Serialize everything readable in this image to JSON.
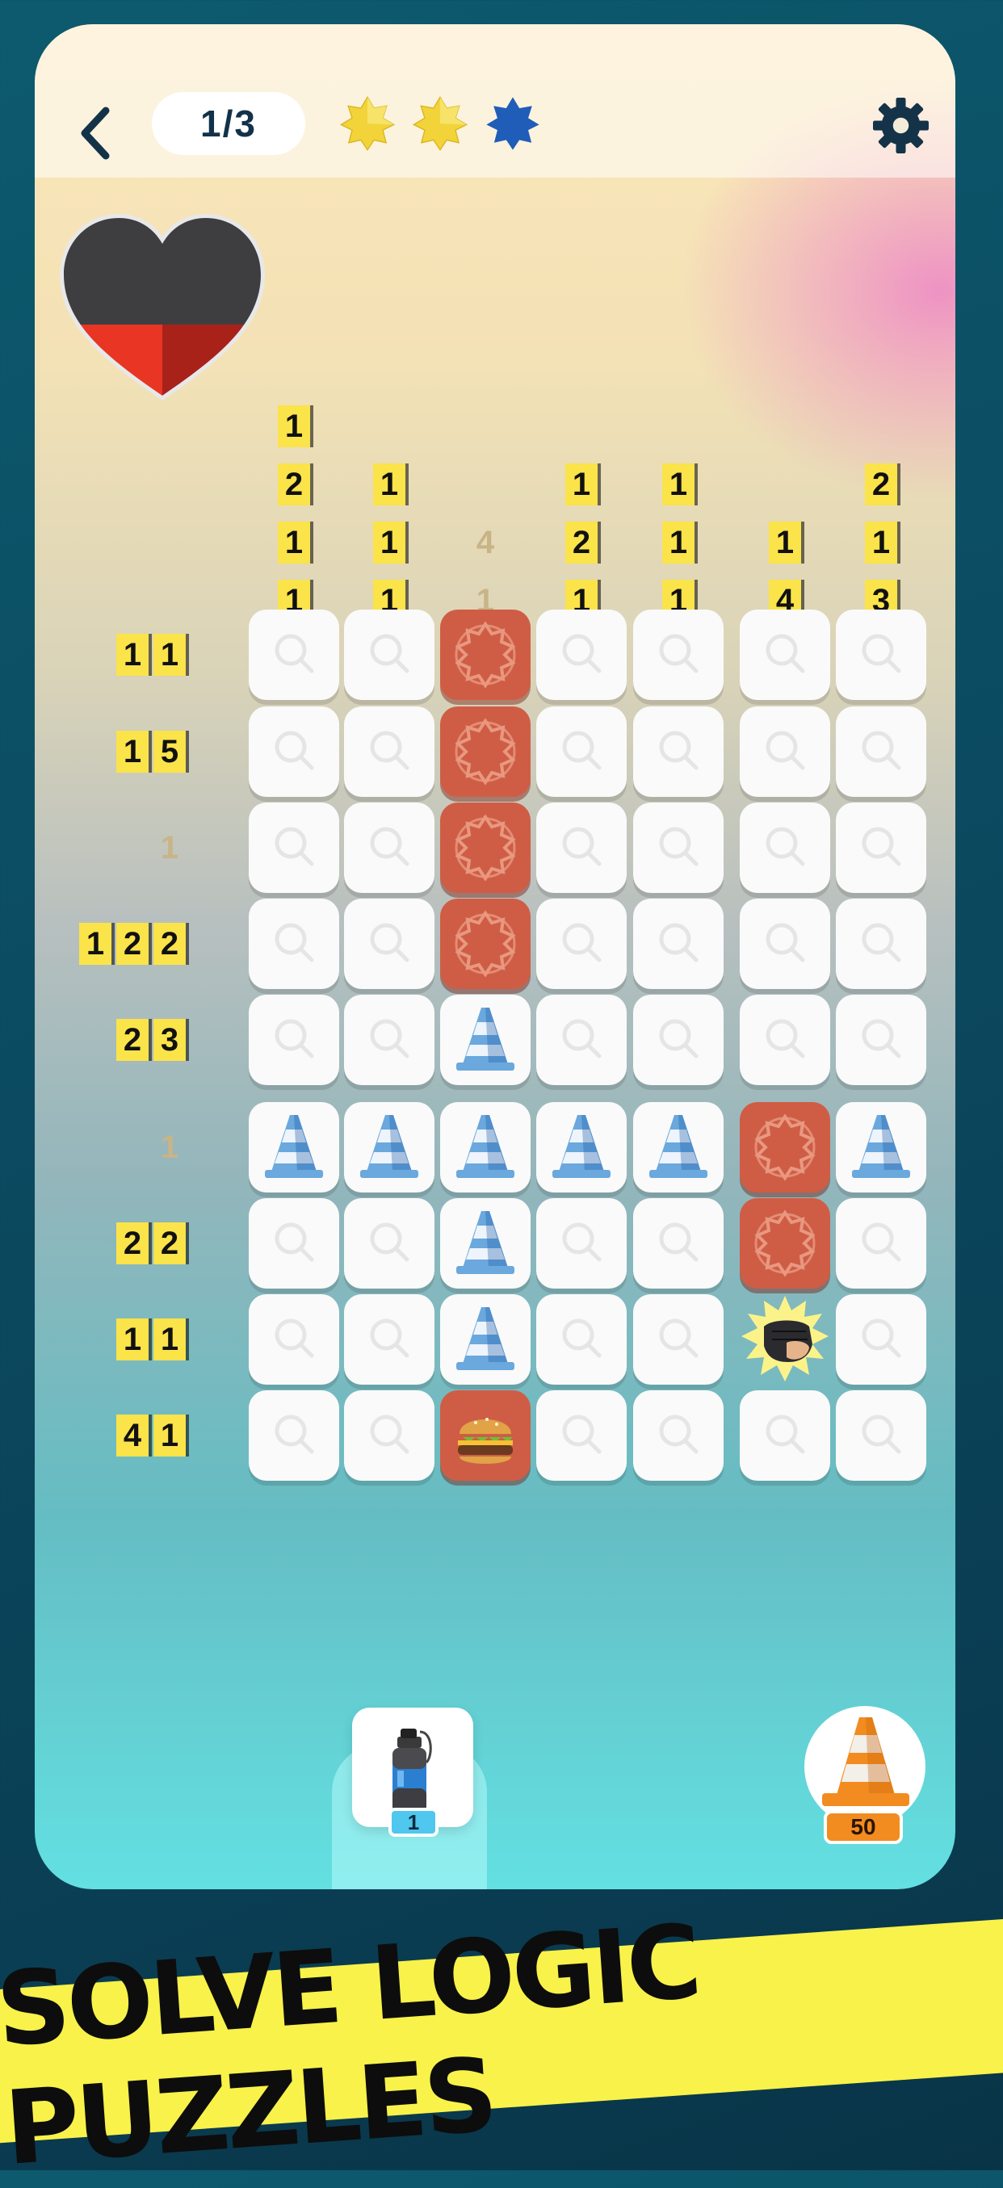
{
  "header": {
    "level_progress": "1/3",
    "stars": [
      {
        "state": "earned",
        "color": "#f2d33a"
      },
      {
        "state": "earned",
        "color": "#f2d33a"
      },
      {
        "state": "current",
        "color": "#1f5db8"
      }
    ],
    "back_icon": "chevron-left-icon",
    "settings_icon": "gear-icon"
  },
  "health": {
    "icon": "heart-icon",
    "fill_fraction": 0.33,
    "fill_color": "#e83524",
    "empty_color": "#3e3e40"
  },
  "column_clues": [
    [
      {
        "v": "1"
      },
      {
        "v": "2"
      },
      {
        "v": "1"
      },
      {
        "v": "1"
      }
    ],
    [
      {
        "v": "1"
      },
      {
        "v": "1"
      },
      {
        "v": "1"
      }
    ],
    [
      {
        "v": "4",
        "done": true
      },
      {
        "v": "1",
        "done": true
      }
    ],
    [
      {
        "v": "1"
      },
      {
        "v": "2"
      },
      {
        "v": "1"
      }
    ],
    [
      {
        "v": "1"
      },
      {
        "v": "1"
      },
      {
        "v": "1"
      }
    ],
    [
      {
        "v": "1"
      },
      {
        "v": "4"
      }
    ],
    [
      {
        "v": "2"
      },
      {
        "v": "1"
      },
      {
        "v": "3"
      }
    ]
  ],
  "row_clues": [
    [
      {
        "v": "1"
      },
      {
        "v": "1"
      }
    ],
    [
      {
        "v": "1"
      },
      {
        "v": "5"
      }
    ],
    [
      {
        "v": "1",
        "done": true
      }
    ],
    [
      {
        "v": "1"
      },
      {
        "v": "2"
      },
      {
        "v": "2"
      }
    ],
    [
      {
        "v": "2"
      },
      {
        "v": "3"
      }
    ],
    [
      {
        "v": "1",
        "done": true
      }
    ],
    [
      {
        "v": "2"
      },
      {
        "v": "2"
      }
    ],
    [
      {
        "v": "1"
      },
      {
        "v": "1"
      }
    ],
    [
      {
        "v": "4"
      },
      {
        "v": "1"
      }
    ]
  ],
  "grid": [
    [
      "unknown",
      "unknown",
      "shield",
      "unknown",
      "unknown",
      "unknown",
      "unknown"
    ],
    [
      "unknown",
      "unknown",
      "shield",
      "unknown",
      "unknown",
      "unknown",
      "unknown"
    ],
    [
      "unknown",
      "unknown",
      "shield",
      "unknown",
      "unknown",
      "unknown",
      "unknown"
    ],
    [
      "unknown",
      "unknown",
      "shield",
      "unknown",
      "unknown",
      "unknown",
      "unknown"
    ],
    [
      "unknown",
      "unknown",
      "cone",
      "unknown",
      "unknown",
      "unknown",
      "unknown"
    ],
    [
      "cone",
      "cone",
      "cone",
      "cone",
      "cone",
      "shield",
      "cone"
    ],
    [
      "unknown",
      "unknown",
      "cone",
      "unknown",
      "unknown",
      "shield",
      "unknown"
    ],
    [
      "unknown",
      "unknown",
      "cone",
      "unknown",
      "unknown",
      "fist",
      "unknown"
    ],
    [
      "unknown",
      "unknown",
      "burger",
      "unknown",
      "unknown",
      "unknown",
      "unknown"
    ]
  ],
  "powerups": {
    "spray": {
      "icon": "spray-can-icon",
      "count": "1"
    },
    "cones": {
      "icon": "traffic-cone-icon",
      "count": "50"
    }
  },
  "banner": {
    "text": "SOLVE LOGIC PUZZLES"
  }
}
